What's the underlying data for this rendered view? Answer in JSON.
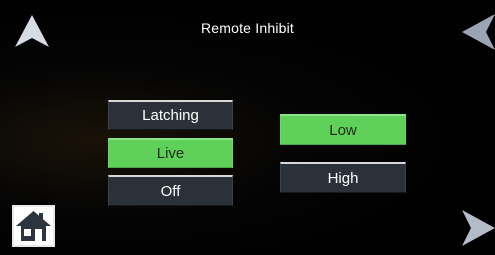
{
  "title": "Remote Inhibit",
  "mode_options": [
    {
      "label": "Latching",
      "selected": false
    },
    {
      "label": "Live",
      "selected": true
    },
    {
      "label": "Off",
      "selected": false
    }
  ],
  "level_options": [
    {
      "label": "Low",
      "selected": true
    },
    {
      "label": "High",
      "selected": false
    }
  ],
  "colors": {
    "background": "#000000",
    "button": "#2a3138",
    "selected": "#5fd05a",
    "arrow": "#c8d0dc"
  },
  "icons": {
    "up": "arrow-up-icon",
    "left": "arrow-left-icon",
    "right": "arrow-right-icon",
    "home": "home-icon"
  }
}
